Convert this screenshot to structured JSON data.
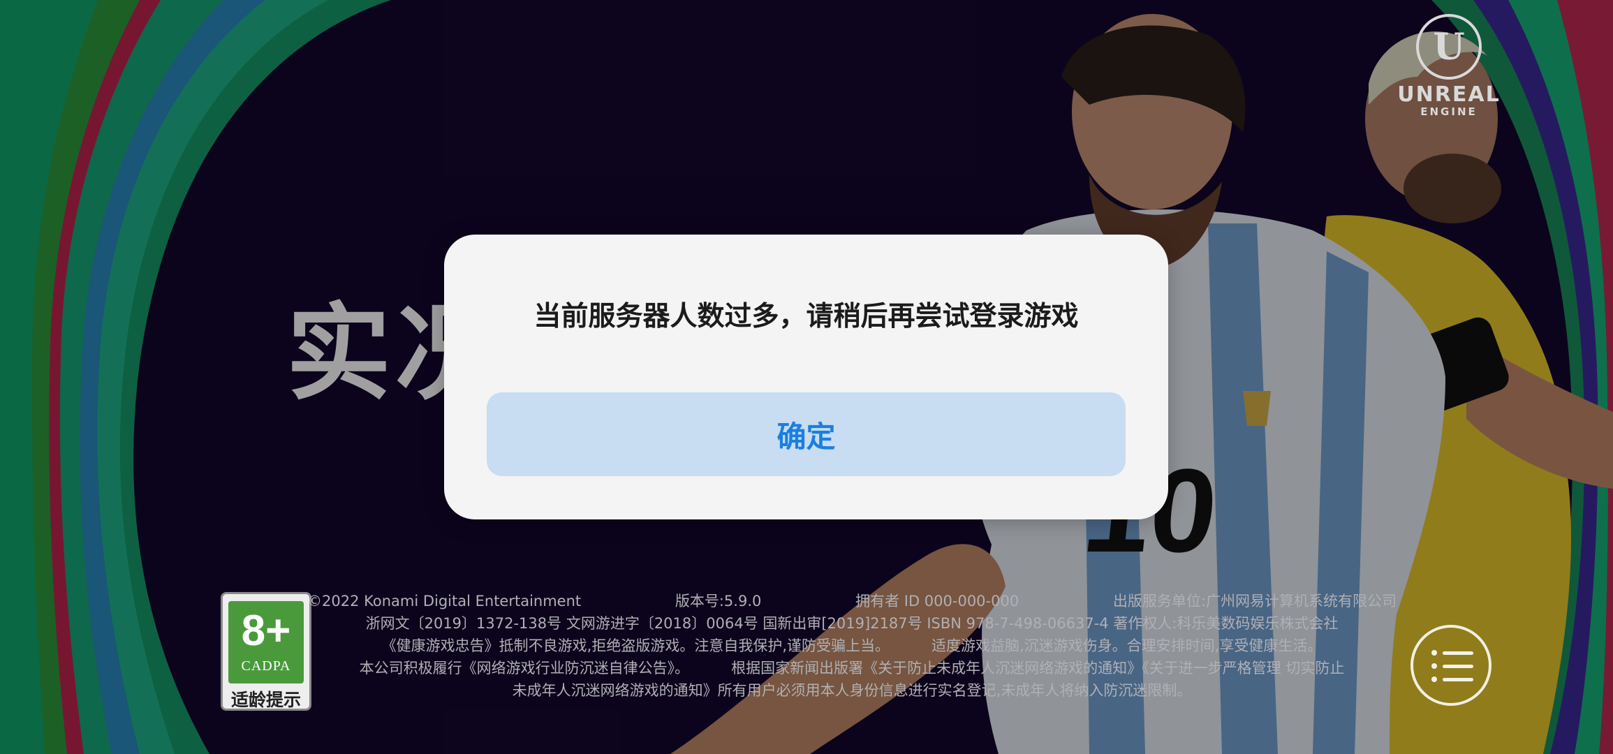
{
  "game": {
    "title_partial": "实况",
    "engine_logo": {
      "word1": "UNREAL",
      "word2": "ENGINE",
      "icon": "unreal-engine-icon"
    }
  },
  "dialog": {
    "message": "当前服务器人数过多，请稍后再尝试登录游戏",
    "confirm_label": "确定"
  },
  "age_rating": {
    "age": "8+",
    "org": "CADPA",
    "label": "适龄提示",
    "color": "#4a9a3c"
  },
  "legal": {
    "copyright": "©2022 Konami Digital Entertainment",
    "version": "版本号:5.9.0",
    "owner_id": "拥有者 ID 000-000-000",
    "publisher": "出版服务单位:广州网易计算机系统有限公司",
    "license": "浙网文〔2019〕1372-138号 文网游进字〔2018〕0064号 国新出审[2019]2187号 ISBN 978-7-498-06637-4 著作权人:科乐美数码娱乐株式会社",
    "health_notice": "《健康游戏忠告》抵制不良游戏,拒绝盗版游戏。注意自我保护,谨防受骗上当。",
    "health_notice_2": "适度游戏益脑,沉迷游戏伤身。合理安排时间,享受健康生活。",
    "anti_addiction_1": "本公司积极履行《网络游戏行业防沉迷自律公告》。",
    "anti_addiction_2": "根据国家新闻出版署《关于防止未成年人沉迷网络游戏的通知》《关于进一步严格管理 切实防止",
    "anti_addiction_3": "未成年人沉迷网络游戏的通知》所有用户必须用本人身份信息进行实名登记,未成年人将纳入防沉迷限制。"
  },
  "menu": {
    "icon": "menu-list-icon"
  },
  "colors": {
    "background": "#14082e",
    "dialog_bg": "#f4f4f4",
    "confirm_bg": "#c8dcf2",
    "confirm_text": "#1a7fe0"
  }
}
